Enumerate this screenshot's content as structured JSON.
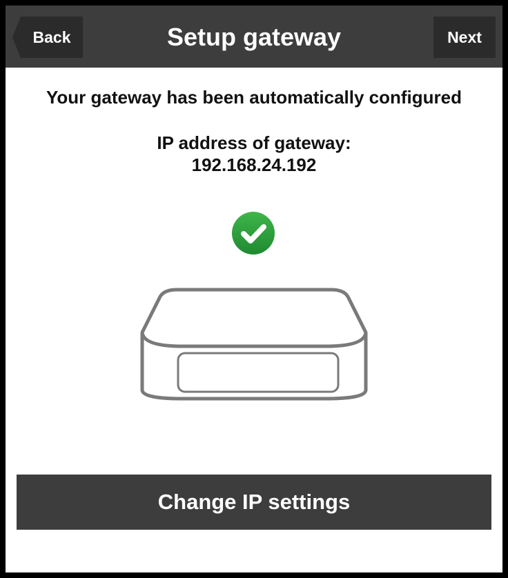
{
  "header": {
    "back_label": "Back",
    "title": "Setup gateway",
    "next_label": "Next"
  },
  "main": {
    "status_message": "Your gateway has been automatically configured",
    "ip_label": "IP address of gateway:",
    "ip_value": "192.168.24.192",
    "status_icon": "checkmark-success-icon",
    "device_icon": "gateway-device-icon"
  },
  "footer": {
    "change_ip_label": "Change IP settings"
  },
  "colors": {
    "header_bg": "#3d3d3d",
    "button_bg": "#2b2b2b",
    "success_green": "#2e9d3b",
    "device_stroke": "#7a7a7a"
  }
}
